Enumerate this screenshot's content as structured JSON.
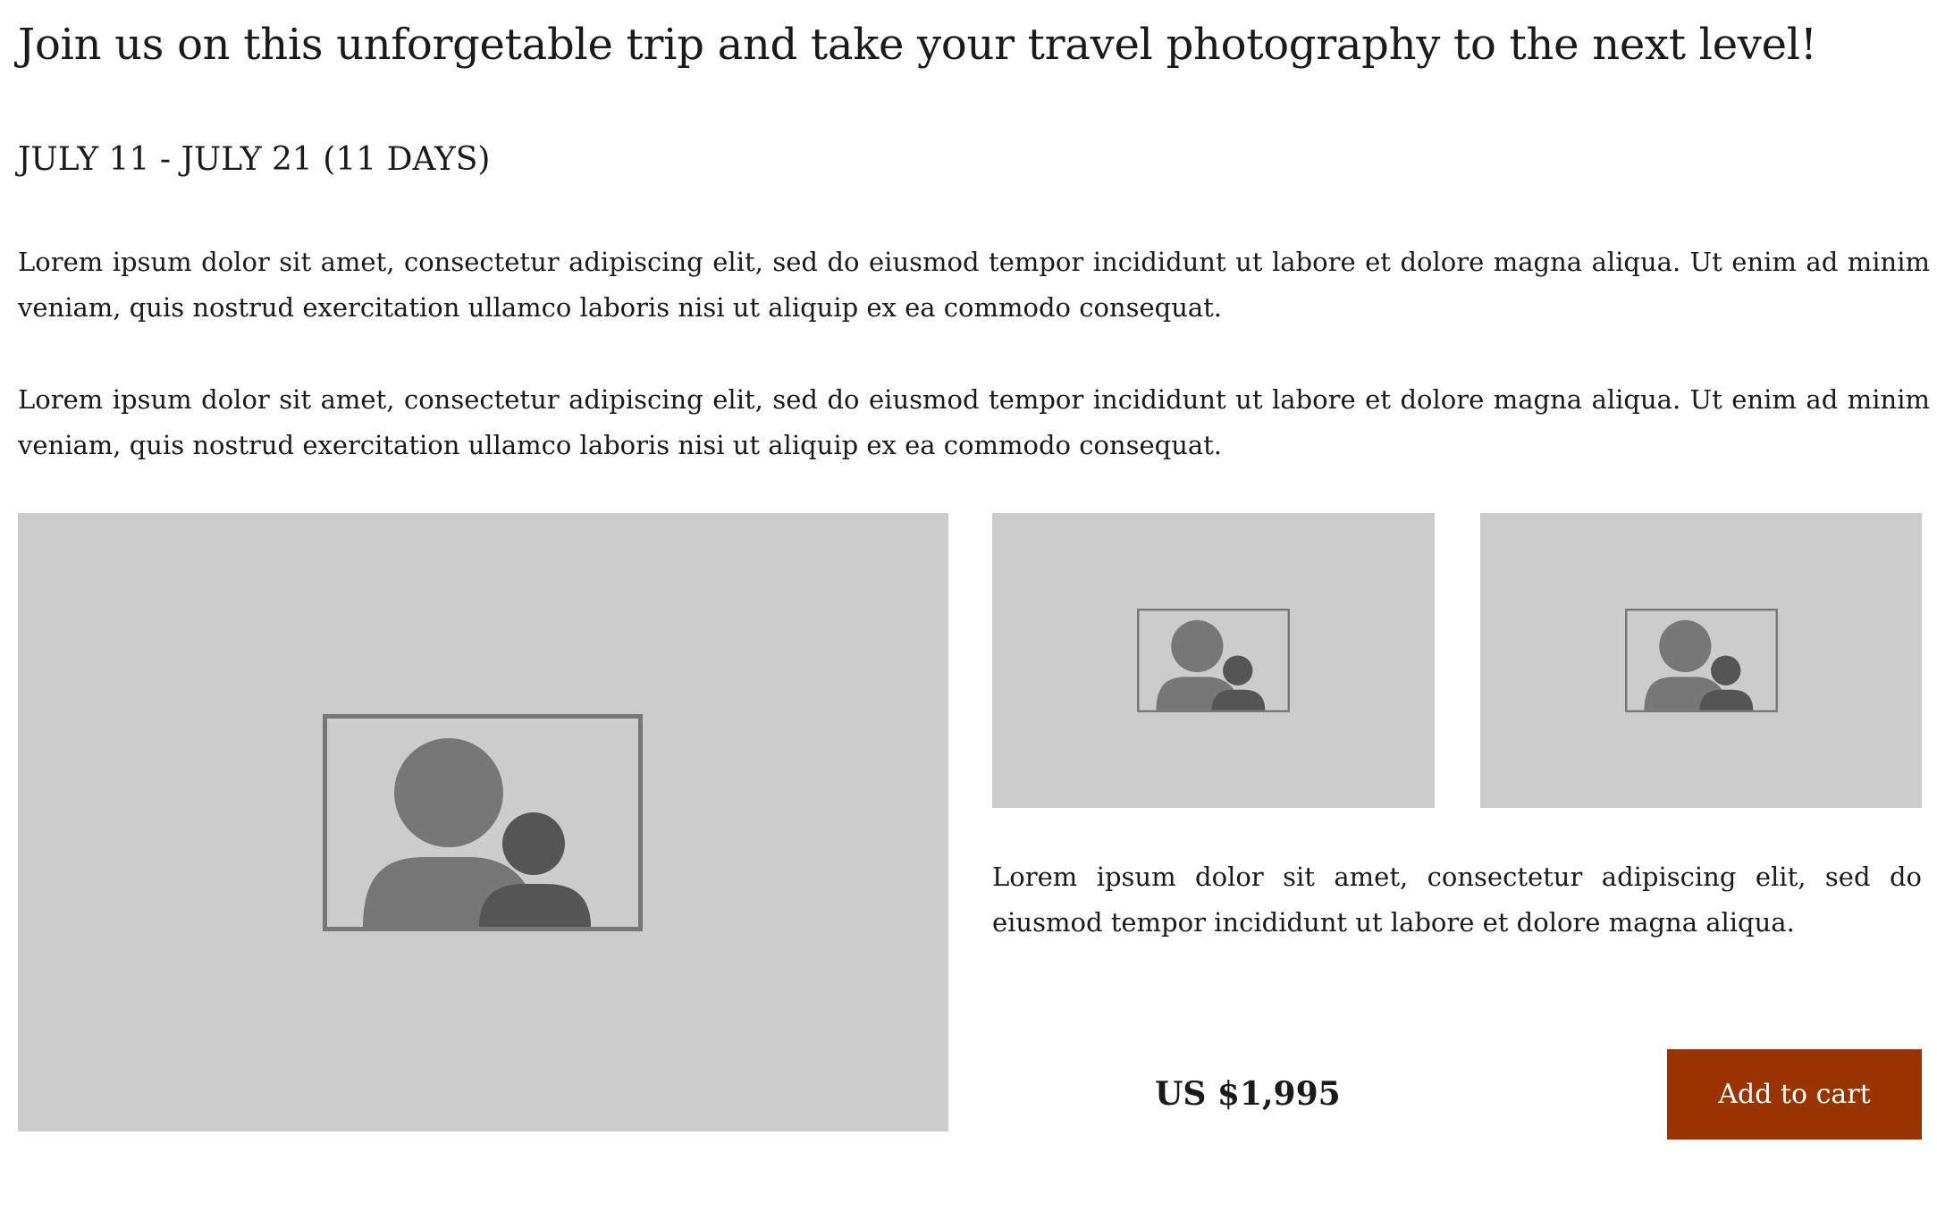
{
  "headline": "Join us on this unforgetable trip and take your travel photography to the next level!",
  "dates": "JULY 11 - JULY 21 (11 DAYS)",
  "paragraphs": [
    "Lorem ipsum dolor sit amet, consectetur adipiscing elit, sed do eiusmod tempor incididunt ut labore et dolore magna aliqua. Ut enim ad minim veniam, quis nostrud exercitation ullamco laboris nisi ut aliquip ex ea commodo consequat.",
    "Lorem ipsum dolor sit amet, consectetur adipiscing elit, sed do eiusmod tempor incididunt ut labore et dolore magna aliqua. Ut enim ad minim veniam, quis nostrud exercitation ullamco laboris nisi ut aliquip ex ea commodo consequat."
  ],
  "gallery": {
    "images": [
      {
        "icon": "image-placeholder-icon"
      },
      {
        "icon": "image-placeholder-icon"
      },
      {
        "icon": "image-placeholder-icon"
      }
    ]
  },
  "product": {
    "description": "Lorem ipsum dolor sit amet, consectetur adipiscing elit, sed do eiusmod tempor incididunt ut labore et dolore magna aliqua.",
    "price": "US $1,995",
    "add_to_cart_label": "Add to cart"
  },
  "colors": {
    "button": "#993300",
    "placeholder_bg": "#cccccc"
  }
}
